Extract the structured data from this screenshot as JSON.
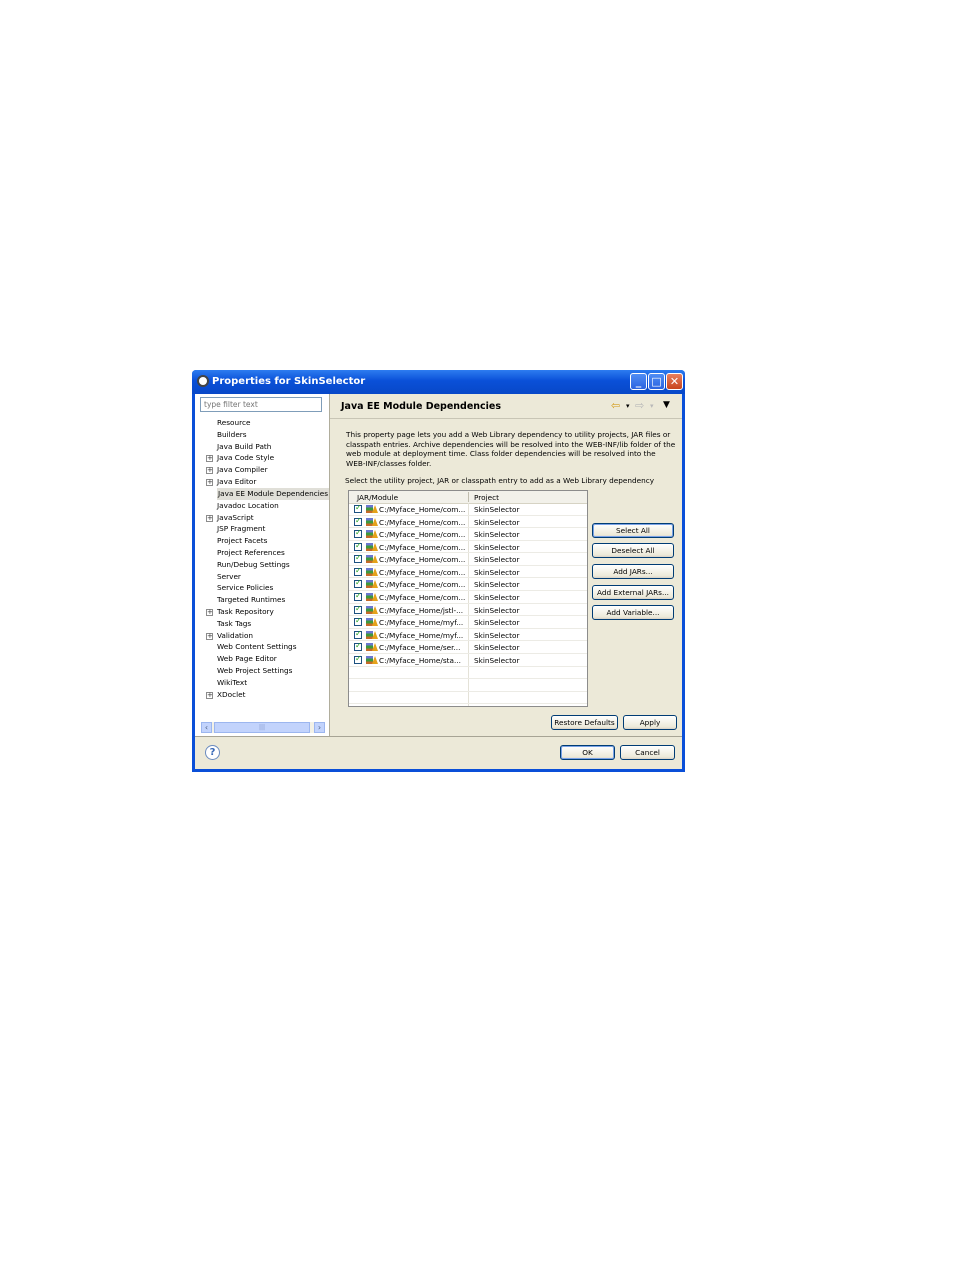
{
  "window": {
    "title": "Properties for SkinSelector",
    "minimize_glyph": "_",
    "maximize_glyph": "□",
    "close_glyph": "✕",
    "icon": "eclipse-gear-icon"
  },
  "filter": {
    "placeholder": "type filter text"
  },
  "tree": {
    "items": [
      {
        "label": "Resource",
        "expandable": false
      },
      {
        "label": "Builders",
        "expandable": false
      },
      {
        "label": "Java Build Path",
        "expandable": false
      },
      {
        "label": "Java Code Style",
        "expandable": true
      },
      {
        "label": "Java Compiler",
        "expandable": true
      },
      {
        "label": "Java Editor",
        "expandable": true
      },
      {
        "label": "Java EE Module Dependencies",
        "expandable": false,
        "selected": true
      },
      {
        "label": "Javadoc Location",
        "expandable": false
      },
      {
        "label": "JavaScript",
        "expandable": true
      },
      {
        "label": "JSP Fragment",
        "expandable": false
      },
      {
        "label": "Project Facets",
        "expandable": false
      },
      {
        "label": "Project References",
        "expandable": false
      },
      {
        "label": "Run/Debug Settings",
        "expandable": false
      },
      {
        "label": "Server",
        "expandable": false
      },
      {
        "label": "Service Policies",
        "expandable": false
      },
      {
        "label": "Targeted Runtimes",
        "expandable": false
      },
      {
        "label": "Task Repository",
        "expandable": true
      },
      {
        "label": "Task Tags",
        "expandable": false
      },
      {
        "label": "Validation",
        "expandable": true
      },
      {
        "label": "Web Content Settings",
        "expandable": false
      },
      {
        "label": "Web Page Editor",
        "expandable": false
      },
      {
        "label": "Web Project Settings",
        "expandable": false
      },
      {
        "label": "WikiText",
        "expandable": false
      },
      {
        "label": "XDoclet",
        "expandable": true
      }
    ],
    "expander_glyph": "+",
    "scroll_left": "‹",
    "scroll_right": "›",
    "scroll_grip": "|||"
  },
  "page": {
    "title": "Java EE Module Dependencies",
    "nav_back": "⇦",
    "nav_forward": "⇨",
    "nav_dropdown": "▾",
    "nav_menu": "▼",
    "description": "This property page lets you add a Web Library dependency to utility projects, JAR files or classpath entries. Archive dependencies will be resolved into the WEB-INF/lib folder of the web module at deployment time. Class folder dependencies will be resolved into the WEB-INF/classes folder.",
    "prompt": "Select the utility project, JAR or classpath entry to add as a Web Library dependency"
  },
  "table": {
    "columns": [
      "JAR/Module",
      "Project"
    ],
    "rows": [
      {
        "jar": "C:/Myface_Home/com...",
        "project": "SkinSelector",
        "checked": true
      },
      {
        "jar": "C:/Myface_Home/com...",
        "project": "SkinSelector",
        "checked": true
      },
      {
        "jar": "C:/Myface_Home/com...",
        "project": "SkinSelector",
        "checked": true
      },
      {
        "jar": "C:/Myface_Home/com...",
        "project": "SkinSelector",
        "checked": true
      },
      {
        "jar": "C:/Myface_Home/com...",
        "project": "SkinSelector",
        "checked": true
      },
      {
        "jar": "C:/Myface_Home/com...",
        "project": "SkinSelector",
        "checked": true
      },
      {
        "jar": "C:/Myface_Home/com...",
        "project": "SkinSelector",
        "checked": true
      },
      {
        "jar": "C:/Myface_Home/com...",
        "project": "SkinSelector",
        "checked": true
      },
      {
        "jar": "C:/Myface_Home/jstl-...",
        "project": "SkinSelector",
        "checked": true
      },
      {
        "jar": "C:/Myface_Home/myf...",
        "project": "SkinSelector",
        "checked": true
      },
      {
        "jar": "C:/Myface_Home/myf...",
        "project": "SkinSelector",
        "checked": true
      },
      {
        "jar": "C:/Myface_Home/ser...",
        "project": "SkinSelector",
        "checked": true
      },
      {
        "jar": "C:/Myface_Home/sta...",
        "project": "SkinSelector",
        "checked": true
      }
    ]
  },
  "buttons": {
    "select_all": "Select All",
    "deselect_all": "Deselect All",
    "add_jars": "Add JARs...",
    "add_external_jars": "Add External JARs...",
    "add_variable": "Add Variable...",
    "restore_defaults": "Restore Defaults",
    "apply": "Apply",
    "ok": "OK",
    "cancel": "Cancel",
    "help": "?"
  },
  "colors": {
    "titlebar": "#0a50d8",
    "dialog_bg": "#ece9d8",
    "checkmark": "#21a121"
  }
}
